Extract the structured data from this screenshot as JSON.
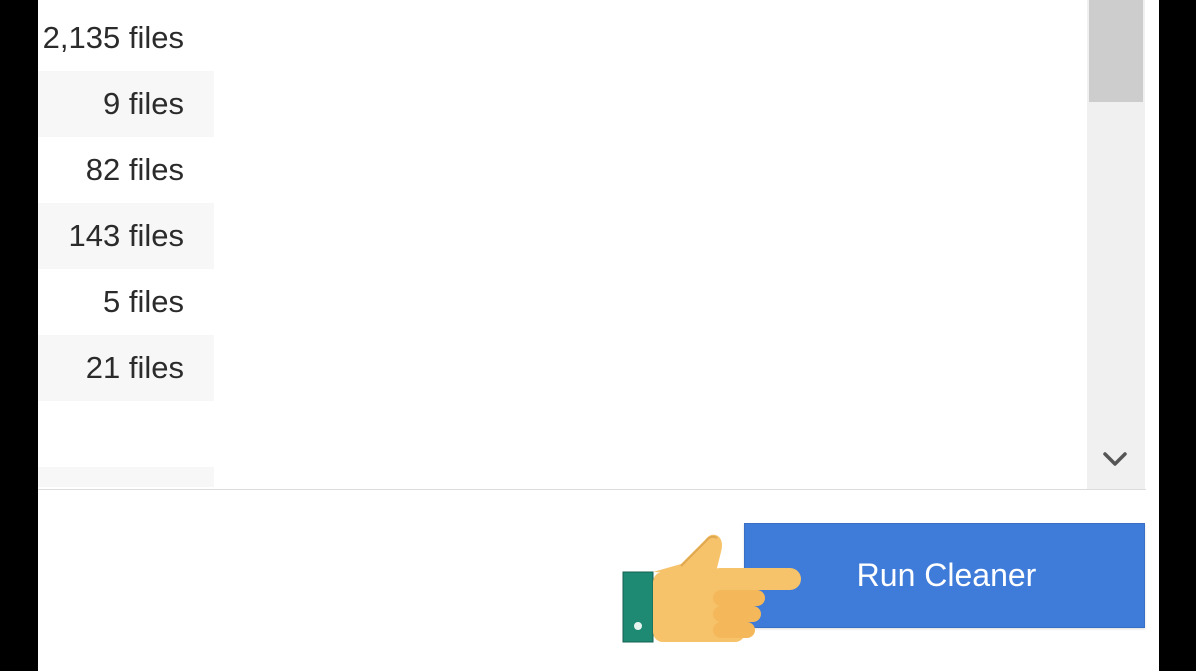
{
  "file_list": {
    "rows": [
      {
        "count_label": "2,135 files"
      },
      {
        "count_label": "9 files"
      },
      {
        "count_label": "82 files"
      },
      {
        "count_label": "143 files"
      },
      {
        "count_label": "5 files"
      },
      {
        "count_label": "21 files"
      },
      {
        "count_label": ""
      },
      {
        "count_label": ""
      }
    ]
  },
  "scrollbar": {
    "down_icon": "chevron-down-icon"
  },
  "actions": {
    "run_cleaner_label": "Run Cleaner"
  },
  "overlay": {
    "icon": "pointing-hand-icon"
  },
  "colors": {
    "button_blue": "#3f7bd9",
    "hand_skin": "#f6c26a",
    "cuff_teal": "#1e8a74"
  }
}
